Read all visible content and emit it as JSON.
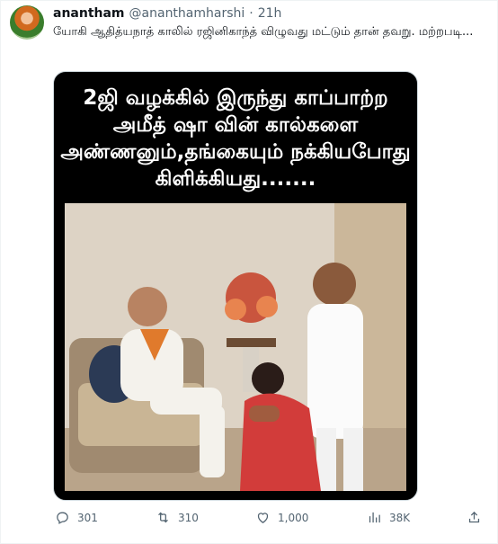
{
  "tweet": {
    "author_name": "anantham",
    "handle": "@ananthamharshi",
    "separator": "·",
    "time": "21h",
    "text": "யோகி ஆதித்யநாத் காலில் ரஜினிகாந்த் விழுவது மட்டும் தான் தவறு. மற்றபடி...",
    "image_caption": "2ஜி வழக்கில் இருந்து காப்பாற்ற அமீத் ஷா வின் கால்களை அண்ணனும்,தங்கையும் நக்கியபோது கிளிக்கியது......."
  },
  "actions": {
    "replies": "301",
    "retweets": "310",
    "likes": "1,000",
    "views": "38K"
  },
  "icons": [
    "reply-icon",
    "retweet-icon",
    "like-icon",
    "views-icon",
    "share-icon"
  ],
  "colors": {
    "icon_gray": "#536471",
    "text": "#0f1419",
    "media_bg": "#000000"
  }
}
